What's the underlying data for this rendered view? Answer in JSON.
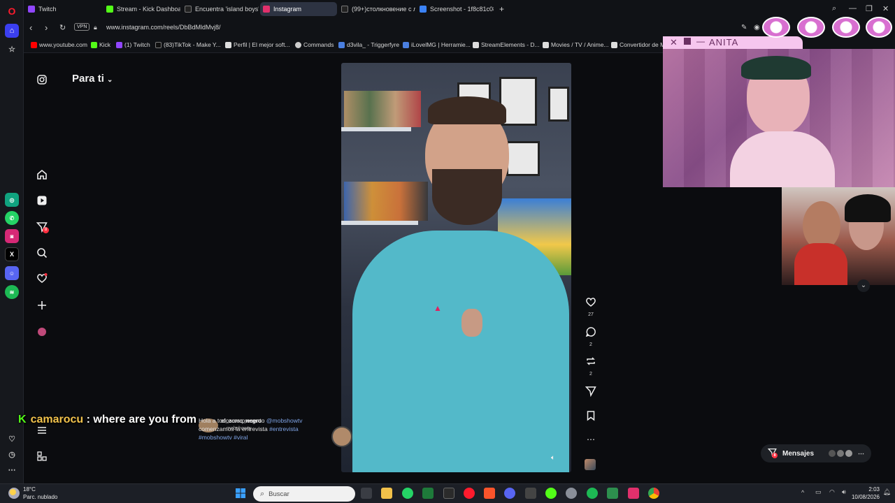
{
  "browser": {
    "tabs": [
      {
        "label": "Twitch",
        "color": "#9146ff",
        "active": false
      },
      {
        "label": "Stream - Kick Dashboard",
        "color": "#53fc18",
        "active": false
      },
      {
        "label": "Encuentra 'island boys' e",
        "color": "#222222",
        "active": false
      },
      {
        "label": "Instagram",
        "color": "#e1306c",
        "active": true
      },
      {
        "label": "(99+)столкновение с лед",
        "color": "#222222",
        "active": false
      },
      {
        "label": "Screenshot - 1f8c81c08b6",
        "color": "#3b82f6",
        "active": false
      }
    ],
    "new_tab": "+",
    "address": {
      "vpn": "VPN",
      "url": "www.instagram.com/reels/DbBdMldMvj8/"
    },
    "bookmarks": [
      {
        "label": "www.youtube.com",
        "color": "#ff0000"
      },
      {
        "label": "Kick",
        "color": "#53fc18"
      },
      {
        "label": "(1) Twitch",
        "color": "#9146ff"
      },
      {
        "label": "(83)TikTok - Make Y...",
        "color": "#111111"
      },
      {
        "label": "Perfil | El mejor soft...",
        "color": "#dddddd"
      },
      {
        "label": "Commands",
        "color": "#cccccc"
      },
      {
        "label": "d3vila_ - Triggerfyre",
        "color": "#4a7fe0"
      },
      {
        "label": "iLovelMG | Herramie...",
        "color": "#4a7fe0"
      },
      {
        "label": "StreamElements - D...",
        "color": "#dddddd"
      },
      {
        "label": "Movies / TV / Anime...",
        "color": "#dddddd"
      },
      {
        "label": "Convertidor de M",
        "color": "#dddddd"
      }
    ]
  },
  "instagram": {
    "feed_label": "Para ti",
    "reel": {
      "likes": "27",
      "comments": "2",
      "reposts": "2",
      "author": "el_zorro_negro",
      "coauthor": "mobshowtv",
      "caption_line1": "Hola a todos os presento",
      "caption_mention": "@mobshowtv",
      "caption_line2": "comenzamos la entrevista",
      "caption_tag1": "#entrevista",
      "caption_tag2": "#mobshowtv",
      "caption_tag3": "#viral"
    },
    "messages_label": "Mensajes",
    "messages_badge": "8",
    "notif_badge": "8"
  },
  "stream": {
    "cam_name": "ANITA",
    "chat_user": "camarocu",
    "chat_sep": " : ",
    "chat_text": "where are you from"
  },
  "taskbar": {
    "temp": "18°C",
    "weather": "Parc. nublado",
    "search_placeholder": "Buscar",
    "time": "2:03",
    "date": "10/08/2026"
  }
}
